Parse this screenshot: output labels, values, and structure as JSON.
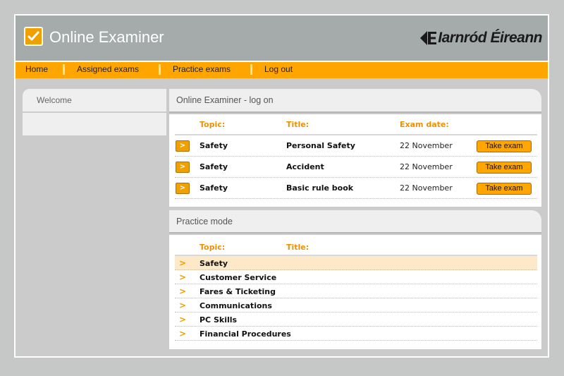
{
  "app": {
    "title": "Online Examiner",
    "brand": "Iarnród Éireann"
  },
  "nav": [
    {
      "label": "Home"
    },
    {
      "label": "Assigned exams"
    },
    {
      "label": "Practice exams"
    },
    {
      "label": "Log out"
    }
  ],
  "sidebar": {
    "welcome": "Welcome"
  },
  "assigned": {
    "title": "Online Examiner - log on",
    "columns": {
      "topic": "Topic:",
      "title": "Title:",
      "date": "Exam date:"
    },
    "rows": [
      {
        "topic": "Safety",
        "title": "Personal Safety",
        "date": "22 November",
        "action": "Take exam"
      },
      {
        "topic": "Safety",
        "title": "Accident",
        "date": "22 November",
        "action": "Take exam"
      },
      {
        "topic": "Safety",
        "title": "Basic rule book",
        "date": "22 November",
        "action": "Take exam"
      }
    ]
  },
  "practice": {
    "title": "Practice mode",
    "columns": {
      "topic": "Topic:",
      "title": "Title:"
    },
    "rows": [
      {
        "topic": "Safety"
      },
      {
        "topic": "Customer Service"
      },
      {
        "topic": "Fares & Ticketing"
      },
      {
        "topic": "Communications"
      },
      {
        "topic": "PC Skills"
      },
      {
        "topic": "Financial Procedures"
      }
    ]
  },
  "colors": {
    "accent": "#ffa500",
    "header": "#a5aaaa",
    "highlight": "#fde9c8",
    "column_heading": "#ee9100"
  }
}
